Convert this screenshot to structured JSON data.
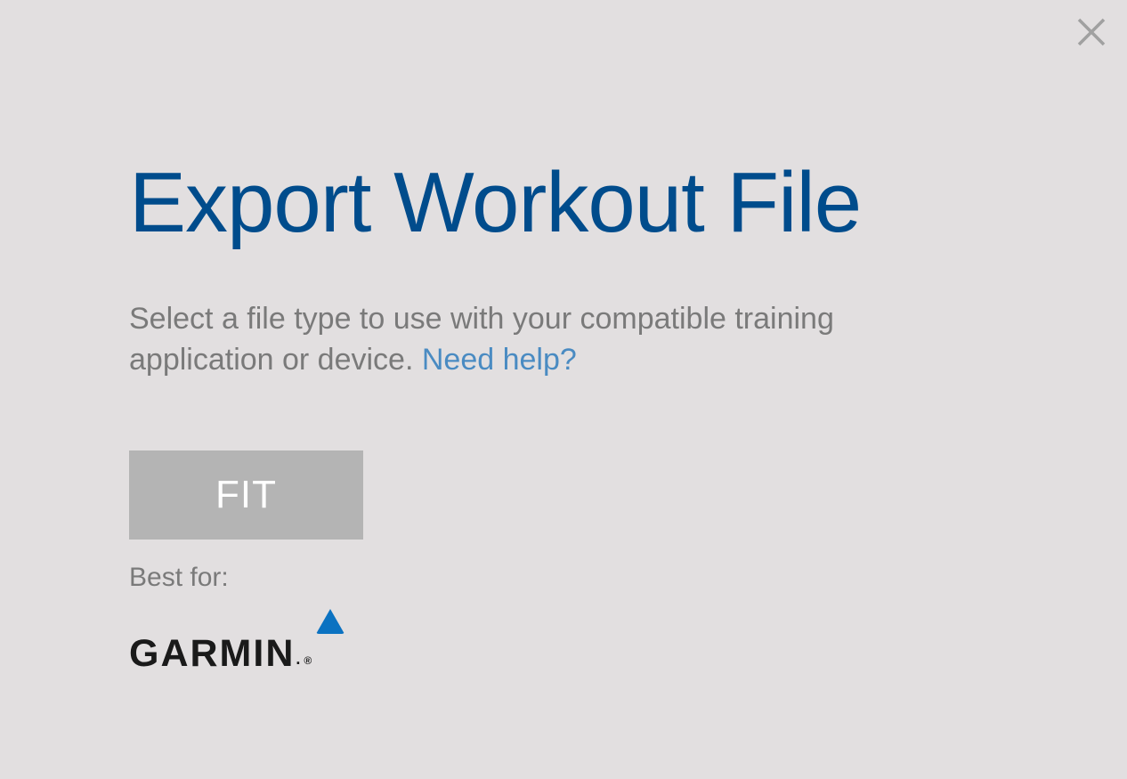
{
  "dialog": {
    "title": "Export Workout File",
    "description": "Select a file type to use with your compatible training application or device. ",
    "help_link": "Need help?",
    "file_type_button": "FIT",
    "best_for_label": "Best for:",
    "brand": "GARMIN"
  }
}
